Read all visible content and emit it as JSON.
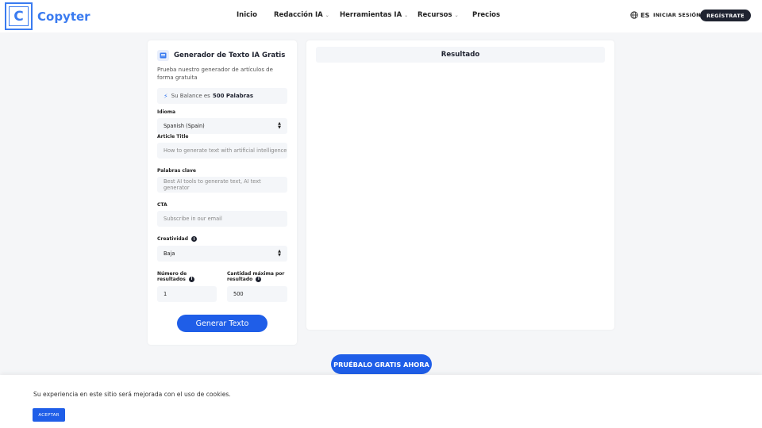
{
  "header": {
    "logo_letter": "C",
    "logo_text": "Copyter",
    "nav": [
      {
        "label": "Inicio"
      },
      {
        "label": "Redacción IA"
      },
      {
        "label": "Herramientas IA"
      },
      {
        "label": "Recursos"
      },
      {
        "label": "Precios"
      }
    ],
    "language": "ES",
    "login_label": "INICIAR SESIÓN",
    "signup_label": "REGÍSTRATE"
  },
  "form": {
    "title": "Generador de Texto IA Gratis",
    "description": "Prueba nuestro generador de artículos de forma gratuita",
    "balance_prefix": "Su Balance es",
    "balance_value": "500 Palabras",
    "language_label": "Idioma",
    "language_value": "Spanish (Spain)",
    "article_title_label": "Article Title",
    "article_title_placeholder": "How to generate text with artificial intelligence",
    "keywords_label": "Palabras clave",
    "keywords_placeholder": "Best AI tools to generate text, AI text generator",
    "cta_label": "CTA",
    "cta_placeholder": "Subscribe in our email",
    "creativity_label": "Creatividad",
    "creativity_value": "Baja",
    "results_count_label": "Número de resultados",
    "results_count_value": "1",
    "max_per_result_label": "Cantidad máxima por resultado",
    "max_per_result_value": "500",
    "generate_label": "Generar Texto"
  },
  "result": {
    "title": "Resultado"
  },
  "cta_button": "PRUÉBALO GRATIS AHORA",
  "cookie": {
    "text": "Su experiencia en este sitio será mejorada con el uso de cookies.",
    "accept_label": "ACEPTAR"
  },
  "colors": {
    "brand": "#3a7bf0",
    "primary_button": "#1f5ee8",
    "dark": "#1f2330",
    "background": "#f5f6f8"
  }
}
